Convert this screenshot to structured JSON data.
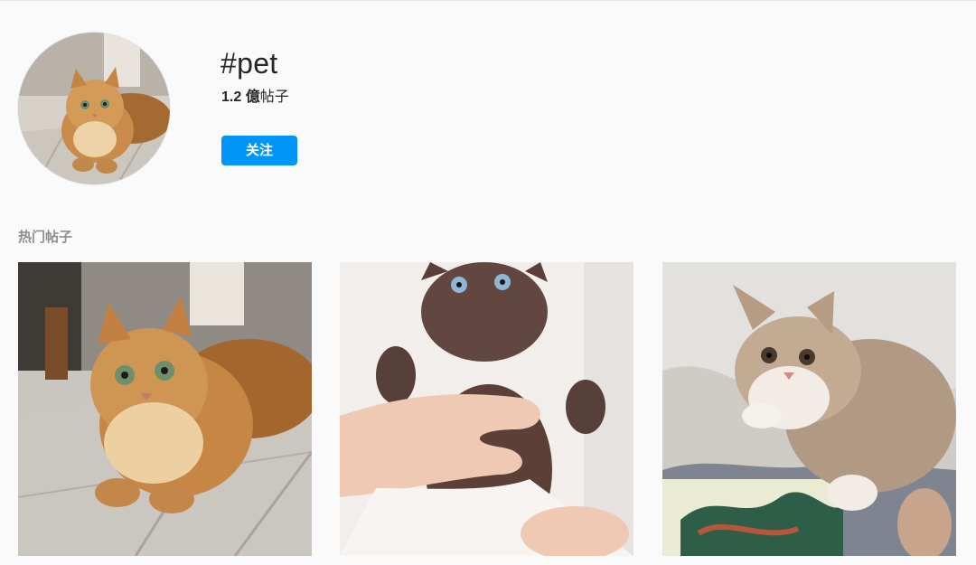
{
  "hashtag": {
    "name": "#pet",
    "post_count_number": "1.2 億",
    "post_count_unit": "帖子",
    "follow_label": "关注"
  },
  "colors": {
    "follow_button": "#0095f6",
    "page_background": "#fafafa",
    "section_label": "#8e8e8e"
  },
  "section": {
    "title": "热门帖子"
  },
  "posts": [
    {
      "subject": "golden long-haired cat lying on tile floor"
    },
    {
      "subject": "brown kitten with blue eyes held in hands"
    },
    {
      "subject": "tabby and white kitten lying on blanket"
    }
  ]
}
